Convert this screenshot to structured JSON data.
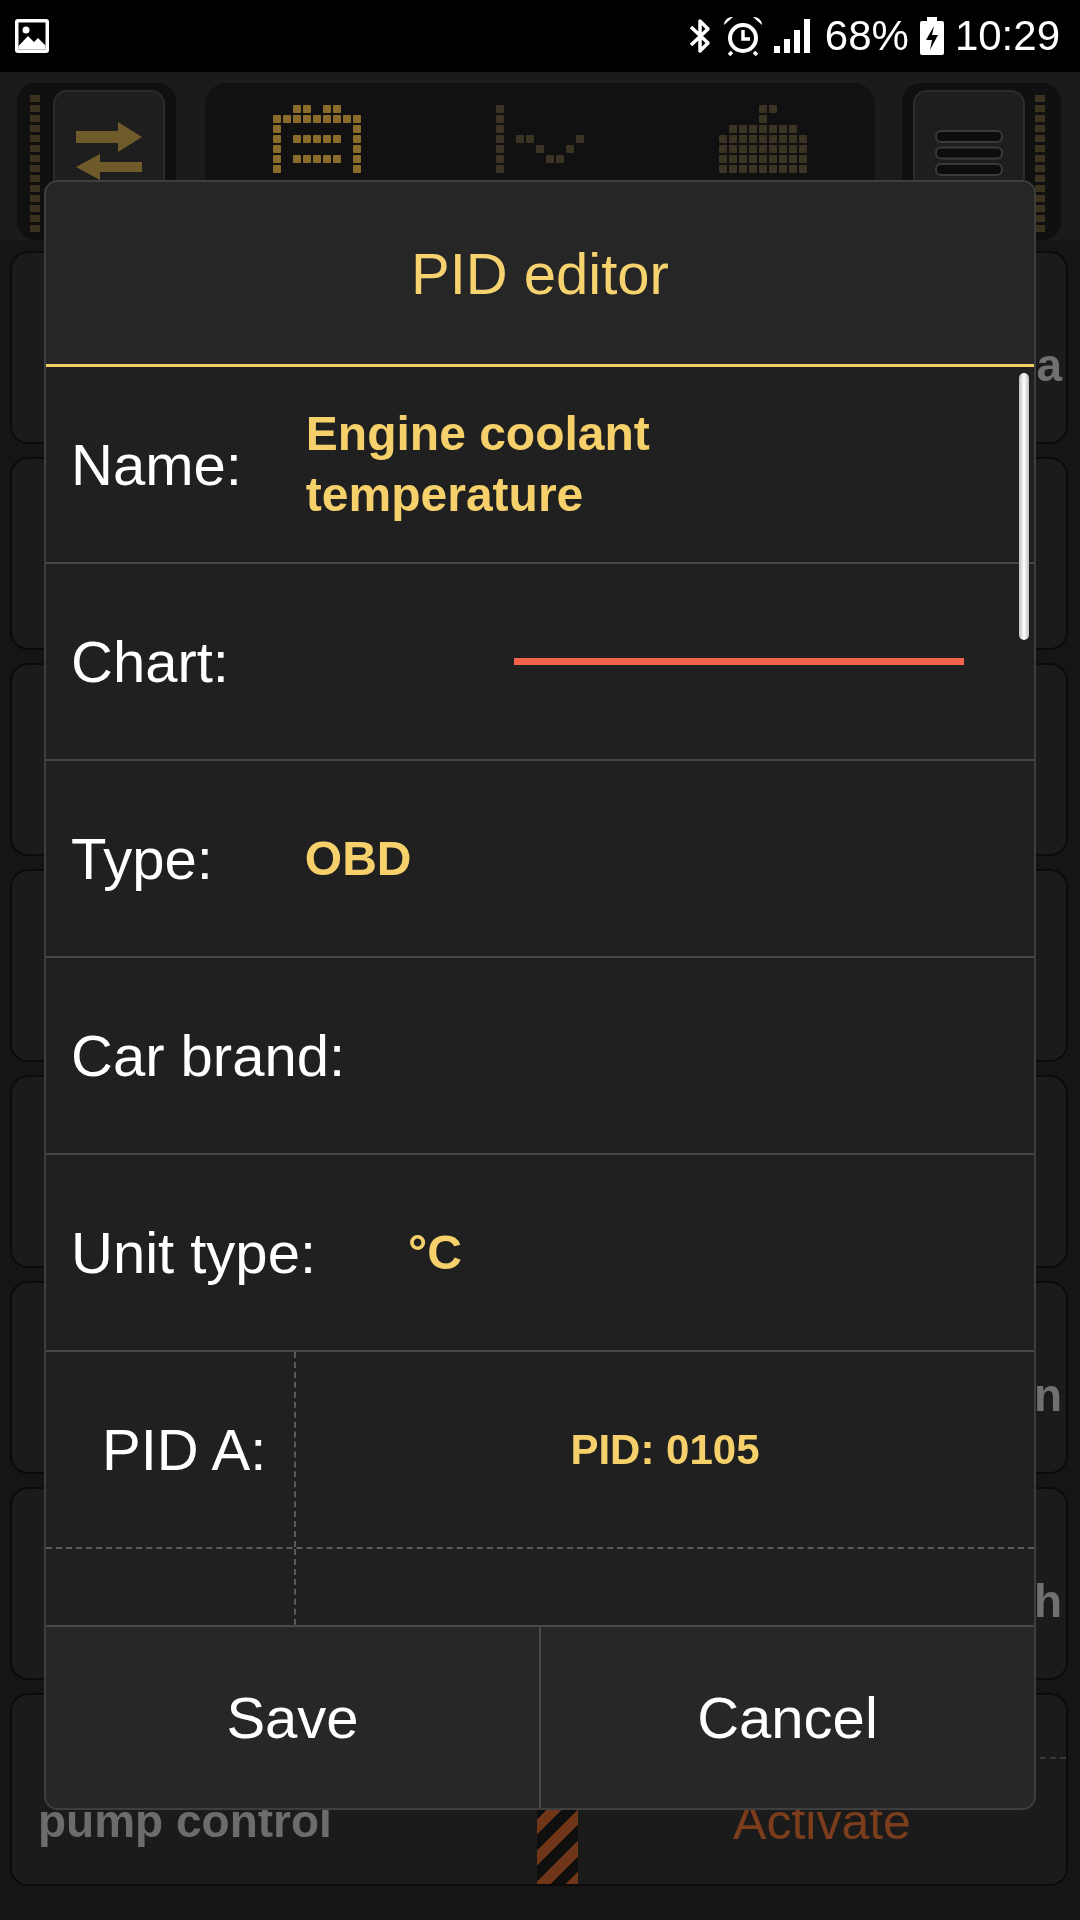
{
  "status_bar": {
    "battery": "68%",
    "time": "10:29"
  },
  "toolbar": {
    "tabs": [
      {
        "selected": true
      },
      {
        "selected": false
      },
      {
        "selected": false
      }
    ]
  },
  "background_cards": [
    {
      "kind": "fragment",
      "text": "a"
    },
    {
      "kind": "plain"
    },
    {
      "kind": "plain"
    },
    {
      "kind": "plain"
    },
    {
      "kind": "plain"
    },
    {
      "kind": "fragment",
      "text": "n"
    },
    {
      "kind": "fragment",
      "text": "h"
    },
    {
      "kind": "action",
      "label": "pump control",
      "button": "Activate"
    }
  ],
  "dialog": {
    "title": "PID editor",
    "rows": [
      {
        "kind": "name",
        "label": "Name:",
        "value": "Engine coolant temperature"
      },
      {
        "kind": "chart",
        "label": "Chart:",
        "color": "#f4634b"
      },
      {
        "kind": "text",
        "label": "Type:",
        "value": "OBD"
      },
      {
        "kind": "text",
        "label": "Car brand:"
      },
      {
        "kind": "text",
        "label": "Unit type:",
        "value": "°C"
      },
      {
        "kind": "pid",
        "label": "PID A:",
        "value": "PID: 0105"
      },
      {
        "kind": "pid"
      }
    ],
    "buttons": [
      "Save",
      "Cancel"
    ]
  }
}
